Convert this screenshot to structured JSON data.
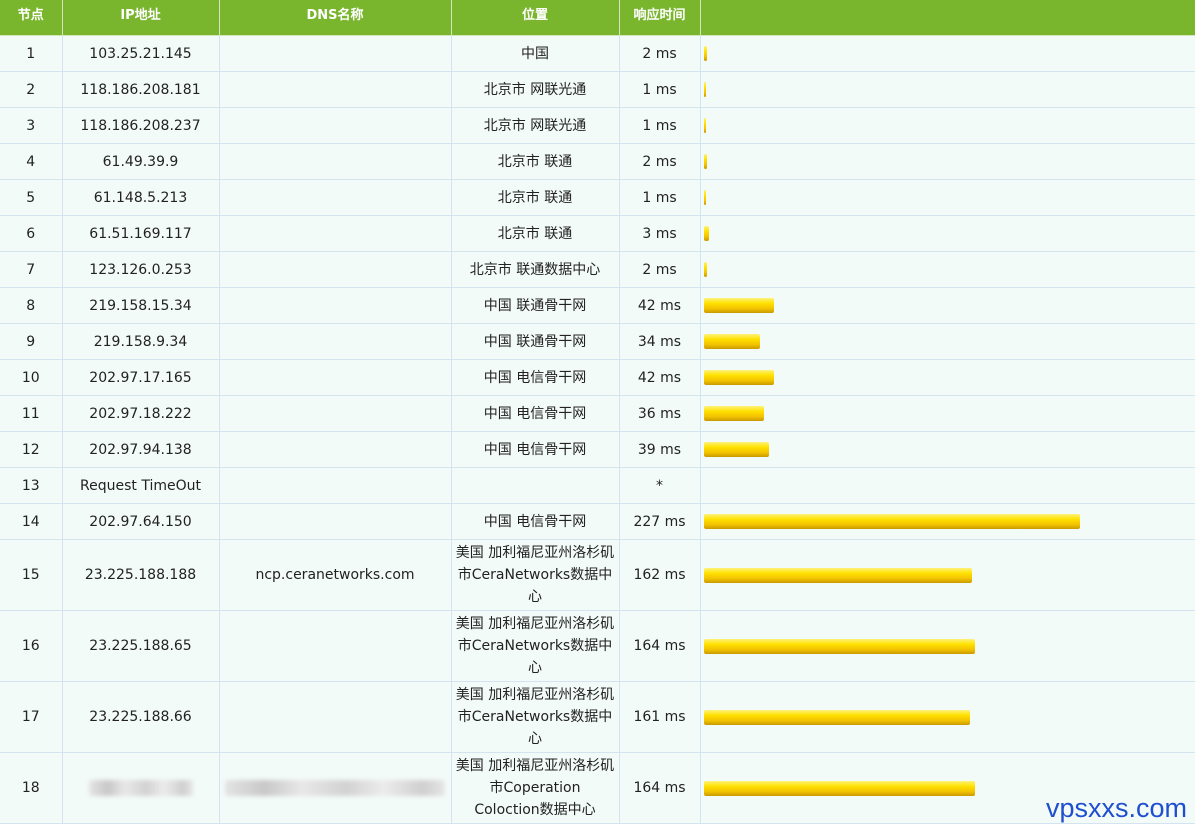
{
  "headers": {
    "node": "节点",
    "ip": "IP地址",
    "dns": "DNS名称",
    "location": "位置",
    "response_time": "响应时间",
    "bar": ""
  },
  "rows": [
    {
      "node": "1",
      "ip": "103.25.21.145",
      "dns": "",
      "location": "中国",
      "time": "2 ms",
      "ms": 2
    },
    {
      "node": "2",
      "ip": "118.186.208.181",
      "dns": "",
      "location": "北京市 网联光通",
      "time": "1 ms",
      "ms": 1
    },
    {
      "node": "3",
      "ip": "118.186.208.237",
      "dns": "",
      "location": "北京市 网联光通",
      "time": "1 ms",
      "ms": 1
    },
    {
      "node": "4",
      "ip": "61.49.39.9",
      "dns": "",
      "location": "北京市 联通",
      "time": "2 ms",
      "ms": 2
    },
    {
      "node": "5",
      "ip": "61.148.5.213",
      "dns": "",
      "location": "北京市 联通",
      "time": "1 ms",
      "ms": 1
    },
    {
      "node": "6",
      "ip": "61.51.169.117",
      "dns": "",
      "location": "北京市 联通",
      "time": "3 ms",
      "ms": 3
    },
    {
      "node": "7",
      "ip": "123.126.0.253",
      "dns": "",
      "location": "北京市 联通数据中心",
      "time": "2 ms",
      "ms": 2
    },
    {
      "node": "8",
      "ip": "219.158.15.34",
      "dns": "",
      "location": "中国 联通骨干网",
      "time": "42 ms",
      "ms": 42
    },
    {
      "node": "9",
      "ip": "219.158.9.34",
      "dns": "",
      "location": "中国 联通骨干网",
      "time": "34 ms",
      "ms": 34
    },
    {
      "node": "10",
      "ip": "202.97.17.165",
      "dns": "",
      "location": "中国 电信骨干网",
      "time": "42 ms",
      "ms": 42
    },
    {
      "node": "11",
      "ip": "202.97.18.222",
      "dns": "",
      "location": "中国 电信骨干网",
      "time": "36 ms",
      "ms": 36
    },
    {
      "node": "12",
      "ip": "202.97.94.138",
      "dns": "",
      "location": "中国 电信骨干网",
      "time": "39 ms",
      "ms": 39
    },
    {
      "node": "13",
      "ip": "Request TimeOut",
      "dns": "",
      "location": "",
      "time": "*",
      "ms": null
    },
    {
      "node": "14",
      "ip": "202.97.64.150",
      "dns": "",
      "location": "中国 电信骨干网",
      "time": "227 ms",
      "ms": 227
    },
    {
      "node": "15",
      "ip": "23.225.188.188",
      "dns": "ncp.ceranetworks.com",
      "location": "美国 加利福尼亚州洛杉矶市CeraNetworks数据中心",
      "time": "162 ms",
      "ms": 162,
      "tall": true
    },
    {
      "node": "16",
      "ip": "23.225.188.65",
      "dns": "",
      "location": "美国 加利福尼亚州洛杉矶市CeraNetworks数据中心",
      "time": "164 ms",
      "ms": 164,
      "tall": true
    },
    {
      "node": "17",
      "ip": "23.225.188.66",
      "dns": "",
      "location": "美国 加利福尼亚州洛杉矶市CeraNetworks数据中心",
      "time": "161 ms",
      "ms": 161,
      "tall": true
    },
    {
      "node": "18",
      "ip": "",
      "dns": "",
      "location": "美国 加利福尼亚州洛杉矶市Coperation Coloction数据中心",
      "time": "164 ms",
      "ms": 164,
      "tall": true,
      "redacted": true
    }
  ],
  "watermark": "vpsxxs.com",
  "colors": {
    "header_bg": "#7ab52e",
    "row_bg": "#f3fbf8",
    "bar": "#ffd700",
    "watermark": "#1e4fcf"
  }
}
